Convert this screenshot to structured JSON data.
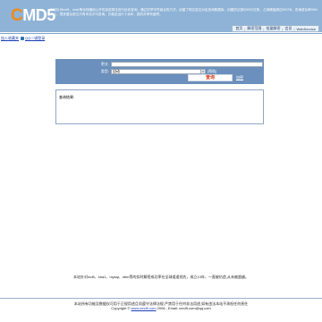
{
  "header": {
    "logo_c": "C",
    "logo_rest": "MD5",
    "intro": "本站针对md5、sha1等全球通用公开的加密算法进行反向查询，通过穷举字符组合的方式，创建了明文密文对应查询数据库，创建的记录约90万亿条，占用硬盘超过500TB，查询成功率95%以上，很多复杂密文只有本站才可查询。已稳定运行十余年，国内外享有盛誉。"
  },
  "topnav": [
    "首页",
    "解密范围",
    "批量解密",
    "会员",
    "WebService"
  ],
  "links": {
    "add_favorite": "加入收藏夹",
    "qq_group": "QQ一键登录"
  },
  "search": {
    "text_label": "密文:",
    "text_value": "",
    "type_label": "类型:",
    "type_value": "自动",
    "help_link": "[帮助]",
    "query_button": "查询",
    "encrypt_link": "加密"
  },
  "result": {
    "label": "查询结果:"
  },
  "notice": "本站针对md5、sha1、mysql、ntlm等的实时解密成功率在全球遥遥领先，成立13年，一直被仿造,从未被超越。",
  "footer": {
    "line1": "本站所有功能及数据仅可用于正规用途且须遵守法律法规,严禁用于任何非法用途,如有违法本站不承担任何责任",
    "copyright_prefix": "Copyright ©",
    "site_link": "www.cmd5.com",
    "copyright_suffix": " 2006 , Email: cmd5.com@qq.com"
  },
  "colors": {
    "header_bg": "#8fb3d6",
    "panel_bg": "#6b90bd",
    "logo_accent": "#f08a18",
    "query_button_text": "#e03a1a"
  }
}
